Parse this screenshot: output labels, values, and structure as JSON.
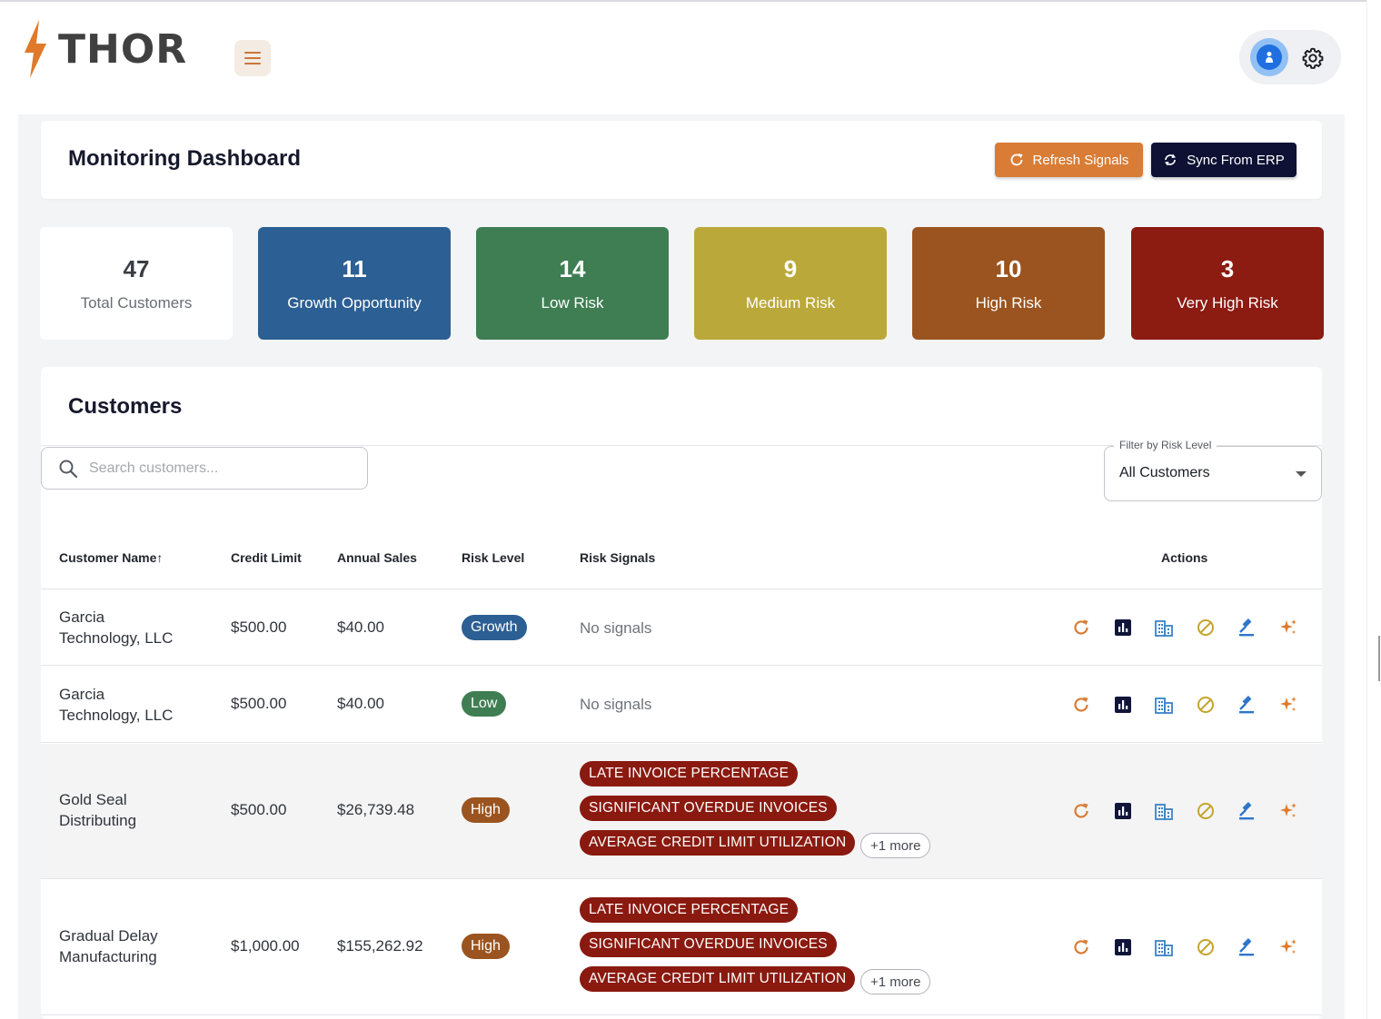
{
  "brand": {
    "name": "THOR"
  },
  "header": {
    "title": "Monitoring Dashboard",
    "refresh_label": "Refresh Signals",
    "sync_label": "Sync From ERP"
  },
  "stats": [
    {
      "value": "47",
      "label": "Total Customers",
      "bg": "#ffffff",
      "fg": "#3a3d44"
    },
    {
      "value": "11",
      "label": "Growth Opportunity",
      "bg": "#2c5f93",
      "fg": "#ffffff"
    },
    {
      "value": "14",
      "label": "Low Risk",
      "bg": "#3f7e53",
      "fg": "#ffffff"
    },
    {
      "value": "9",
      "label": "Medium Risk",
      "bg": "#bba83a",
      "fg": "#ffffff"
    },
    {
      "value": "10",
      "label": "High Risk",
      "bg": "#9b541f",
      "fg": "#ffffff"
    },
    {
      "value": "3",
      "label": "Very High Risk",
      "bg": "#8c1b12",
      "fg": "#ffffff"
    }
  ],
  "customers": {
    "title": "Customers",
    "search_placeholder": "Search customers...",
    "filter": {
      "legend": "Filter by Risk Level",
      "value": "All Customers"
    },
    "columns": {
      "name": "Customer Name",
      "sort_indicator": "↑",
      "credit": "Credit Limit",
      "sales": "Annual Sales",
      "risk": "Risk Level",
      "signals": "Risk Signals",
      "actions": "Actions"
    },
    "rows": [
      {
        "name_line1": "Garcia",
        "name_line2": "Technology, LLC",
        "credit": "$500.00",
        "sales": "$40.00",
        "risk": "Growth",
        "risk_color": "#2c5f93",
        "no_signals": "No signals"
      },
      {
        "name_line1": "Garcia",
        "name_line2": "Technology, LLC",
        "credit": "$500.00",
        "sales": "$40.00",
        "risk": "Low",
        "risk_color": "#3f7e53",
        "no_signals": "No signals"
      },
      {
        "name_line1": "Gold Seal",
        "name_line2": "Distributing",
        "credit": "$500.00",
        "sales": "$26,739.48",
        "risk": "High",
        "risk_color": "#9b541f",
        "signals": [
          "LATE INVOICE PERCENTAGE",
          "SIGNIFICANT OVERDUE INVOICES",
          "AVERAGE CREDIT LIMIT UTILIZATION"
        ],
        "more": "+1 more"
      },
      {
        "name_line1": "Gradual Delay",
        "name_line2": "Manufacturing",
        "credit": "$1,000.00",
        "sales": "$155,262.92",
        "risk": "High",
        "risk_color": "#9b541f",
        "signals": [
          "LATE INVOICE PERCENTAGE",
          "SIGNIFICANT OVERDUE INVOICES",
          "AVERAGE CREDIT LIMIT UTILIZATION"
        ],
        "more": "+1 more"
      }
    ],
    "action_icons": [
      "refresh-icon",
      "chart-icon",
      "building-icon",
      "block-icon",
      "gavel-icon",
      "sparkle-icon"
    ]
  }
}
